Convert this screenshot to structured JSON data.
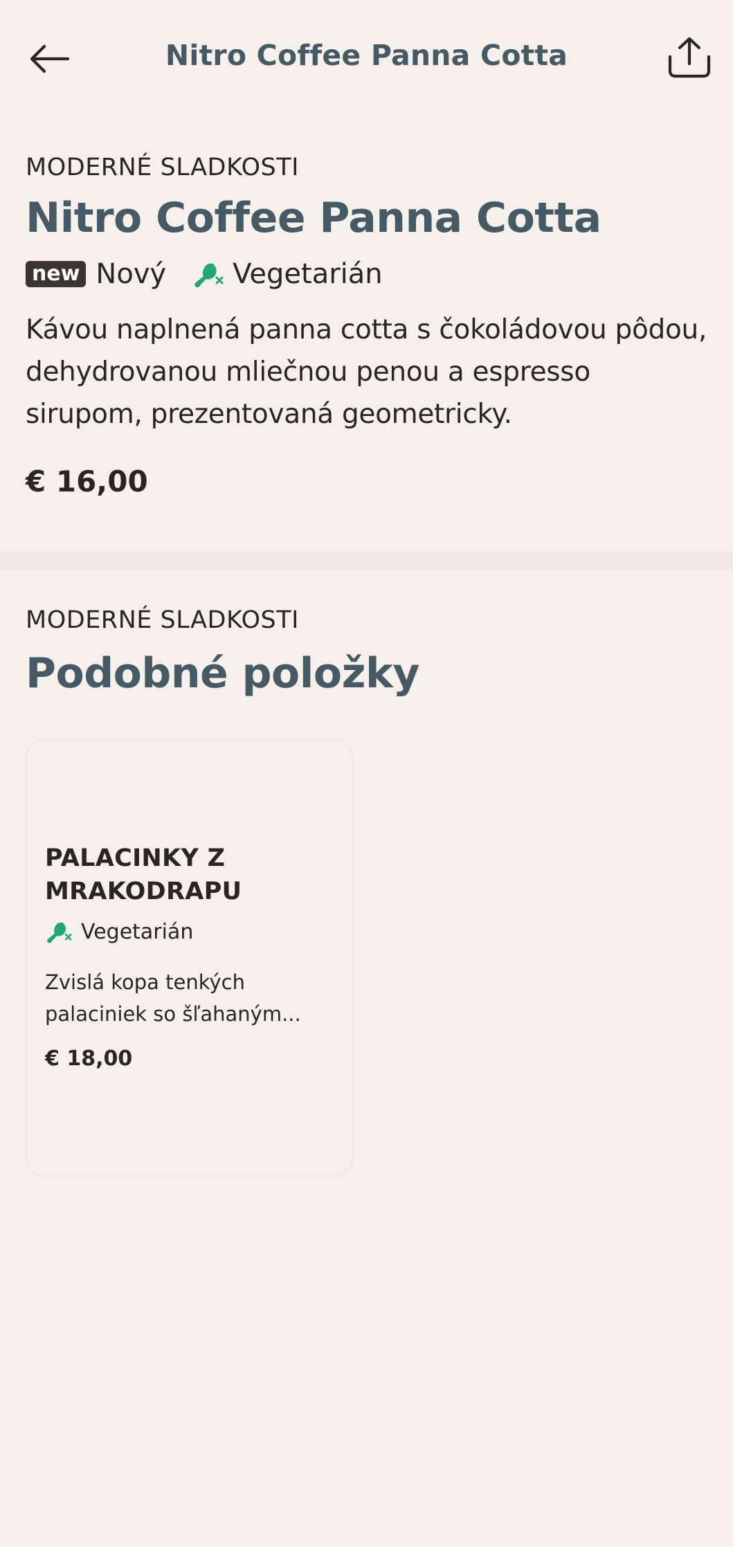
{
  "header": {
    "title": "Nitro Coffee Panna Cotta",
    "back_icon": "arrow-left-icon",
    "share_icon": "share-icon"
  },
  "product": {
    "category": "MODERNÉ SLADKOSTI",
    "title": "Nitro Coffee Panna Cotta",
    "badge": "new",
    "badge_label": "Nový",
    "diet_label": "Vegetarián",
    "description": "Kávou naplnená panna cotta s čokoládovou pôdou, dehydrovanou mliečnou penou a espresso sirupom, prezentovaná geometricky.",
    "price": "€ 16,00"
  },
  "similar": {
    "category": "MODERNÉ SLADKOSTI",
    "title": "Podobné položky",
    "items": [
      {
        "title": "PALACINKY Z MRAKODRAPU",
        "diet_label": "Vegetarián",
        "description": "Zvislá kopa tenkých palaciniek so šľahaným...",
        "price": "€ 18,00"
      }
    ]
  },
  "colors": {
    "background": "#f6f0eb",
    "title": "#465a66",
    "text": "#2a2523",
    "badge_bg": "#3b3532",
    "vegetarian_green": "#1fa67a"
  }
}
